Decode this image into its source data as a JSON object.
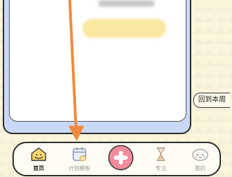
{
  "back_to_week": "回到本周",
  "tabs": [
    {
      "label": "首页",
      "icon": "home-icon",
      "active": true
    },
    {
      "label": "计划模板",
      "icon": "calendar-template-icon",
      "active": false
    },
    {
      "label": "专注",
      "icon": "hourglass-icon",
      "active": false
    },
    {
      "label": "我的",
      "icon": "profile-icon",
      "active": false
    }
  ],
  "add_button_icon": "plus-icon",
  "colors": {
    "accent_orange": "#f08a3c",
    "add_button": "#f28b9b",
    "card_blue": "#c9d8f6",
    "pill_yellow": "#fbe9a2"
  }
}
